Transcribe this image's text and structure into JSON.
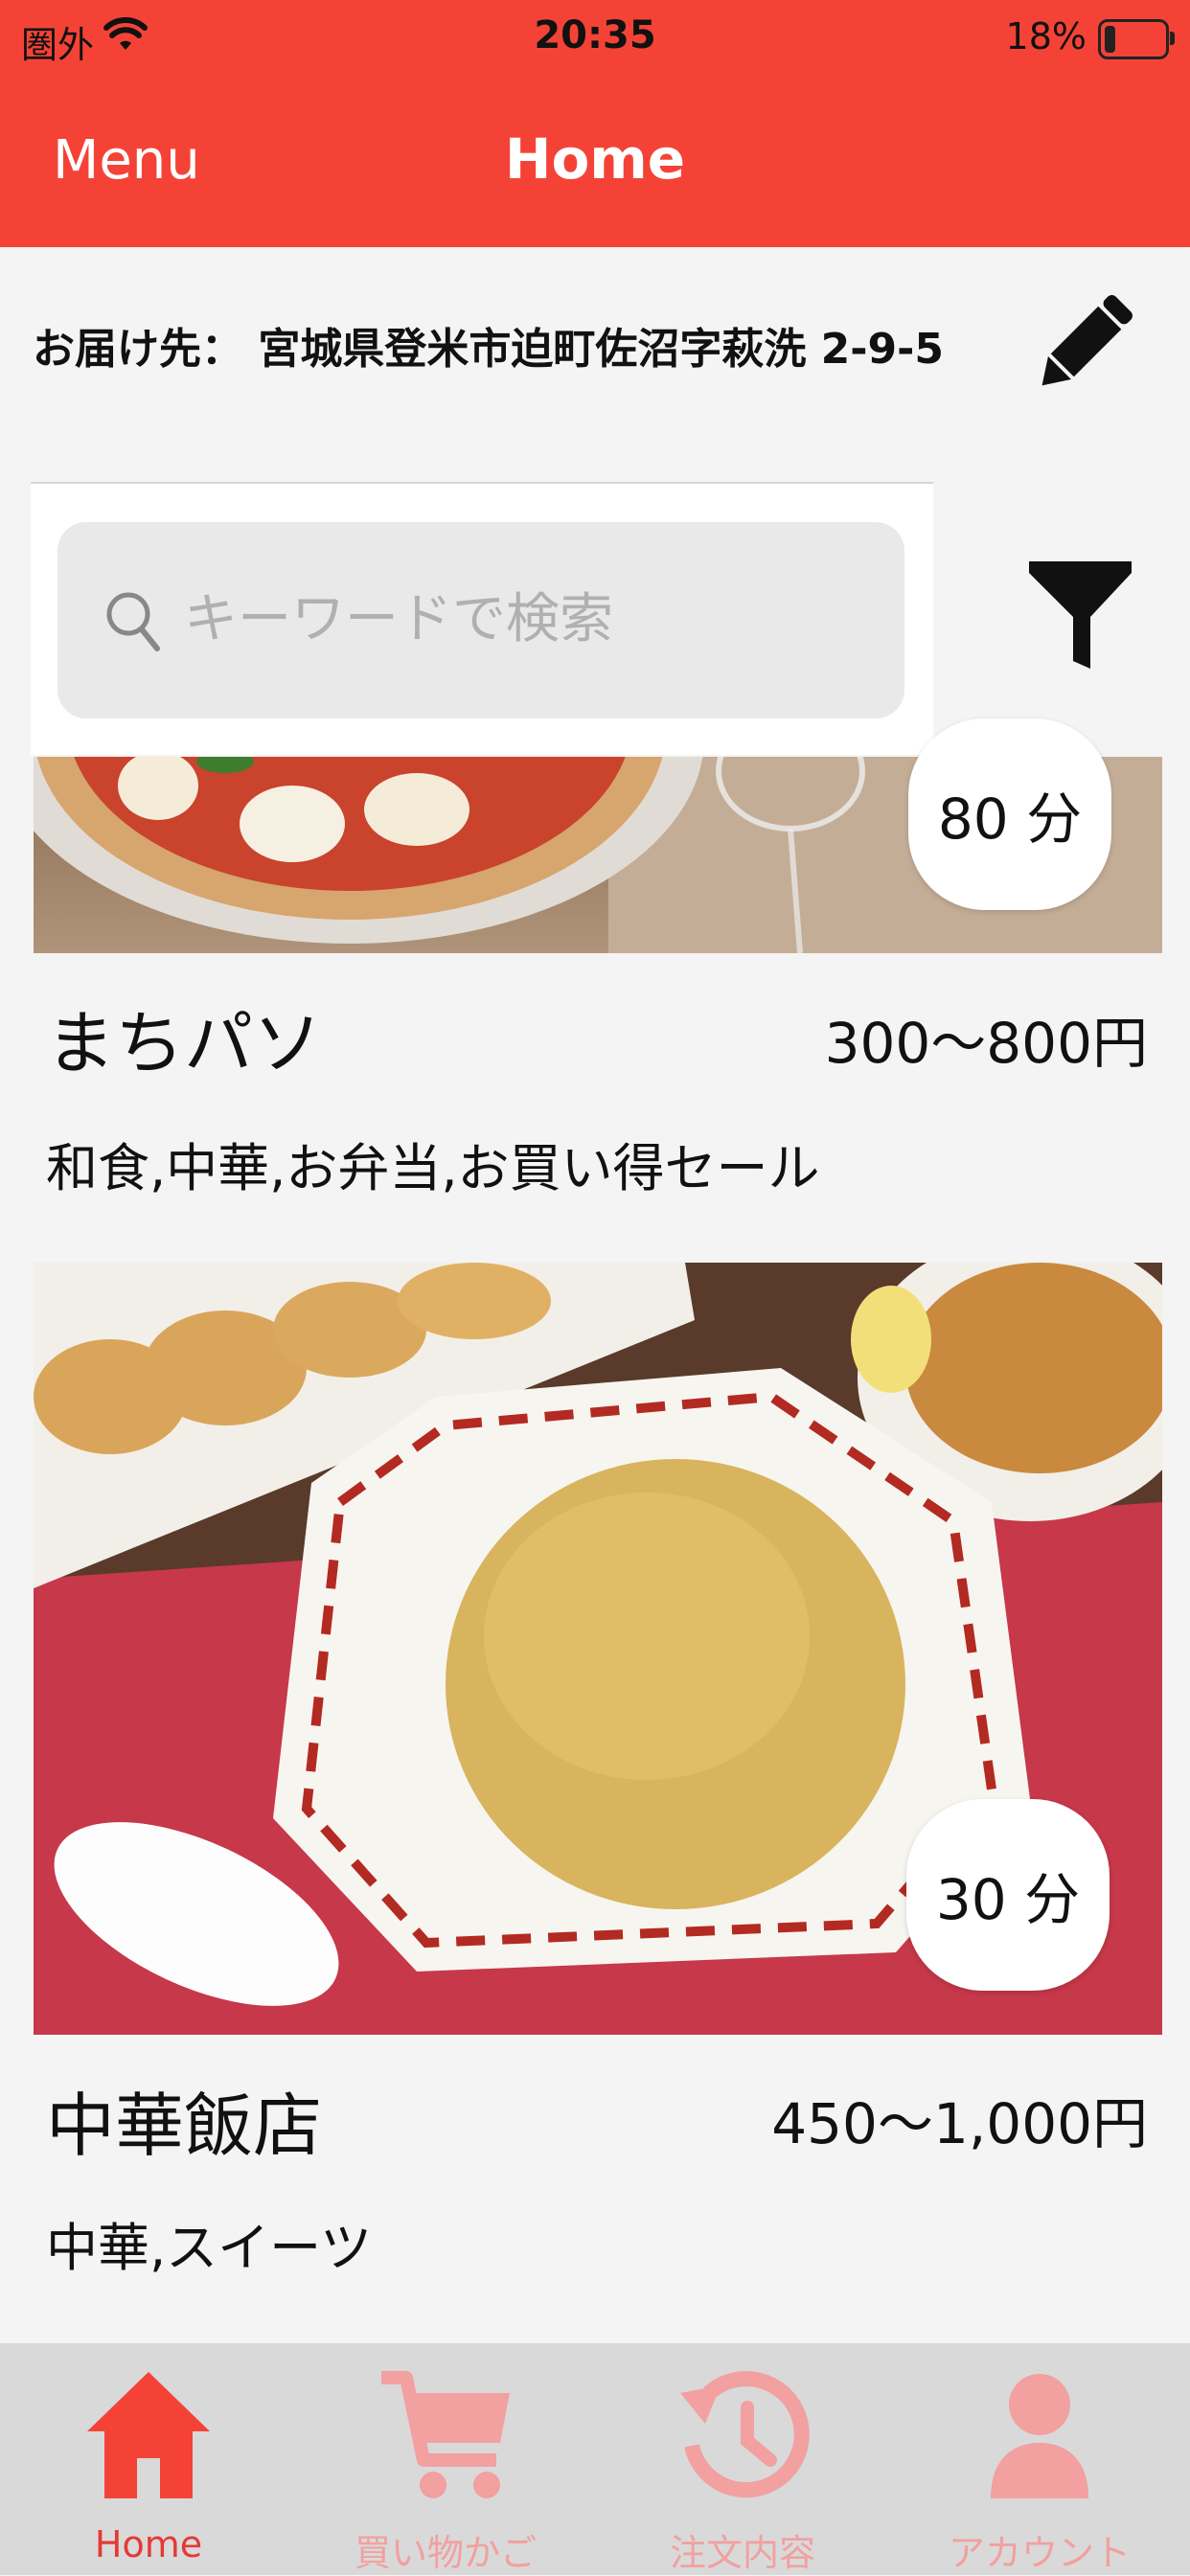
{
  "status_bar": {
    "carrier": "圏外",
    "time": "20:35",
    "battery": "18%",
    "battery_level": 0.18
  },
  "nav": {
    "menu_label": "Menu",
    "title": "Home"
  },
  "address": {
    "text": "お届け先： 宮城県登米市迫町佐沼字萩洗 2-9-5"
  },
  "search": {
    "placeholder": "キーワードで検索",
    "value": ""
  },
  "restaurants": [
    {
      "eta": "80 分",
      "name": "まちパソ",
      "price": "300〜800円",
      "tags": "和食,中華,お弁当,お買い得セール"
    },
    {
      "eta": "30 分",
      "name": "中華飯店",
      "price": "450〜1,000円",
      "tags": "中華,スイーツ"
    }
  ],
  "tabs": [
    {
      "label": "Home",
      "icon": "home-icon",
      "active": true
    },
    {
      "label": "買い物かご",
      "icon": "cart-icon",
      "active": false
    },
    {
      "label": "注文内容",
      "icon": "history-icon",
      "active": false
    },
    {
      "label": "アカウント",
      "icon": "account-icon",
      "active": false
    }
  ],
  "colors": {
    "primary": "#f44336",
    "tab_active": "#e53935",
    "tab_inactive": "#f2a0a0",
    "background": "#f4f4f4"
  }
}
